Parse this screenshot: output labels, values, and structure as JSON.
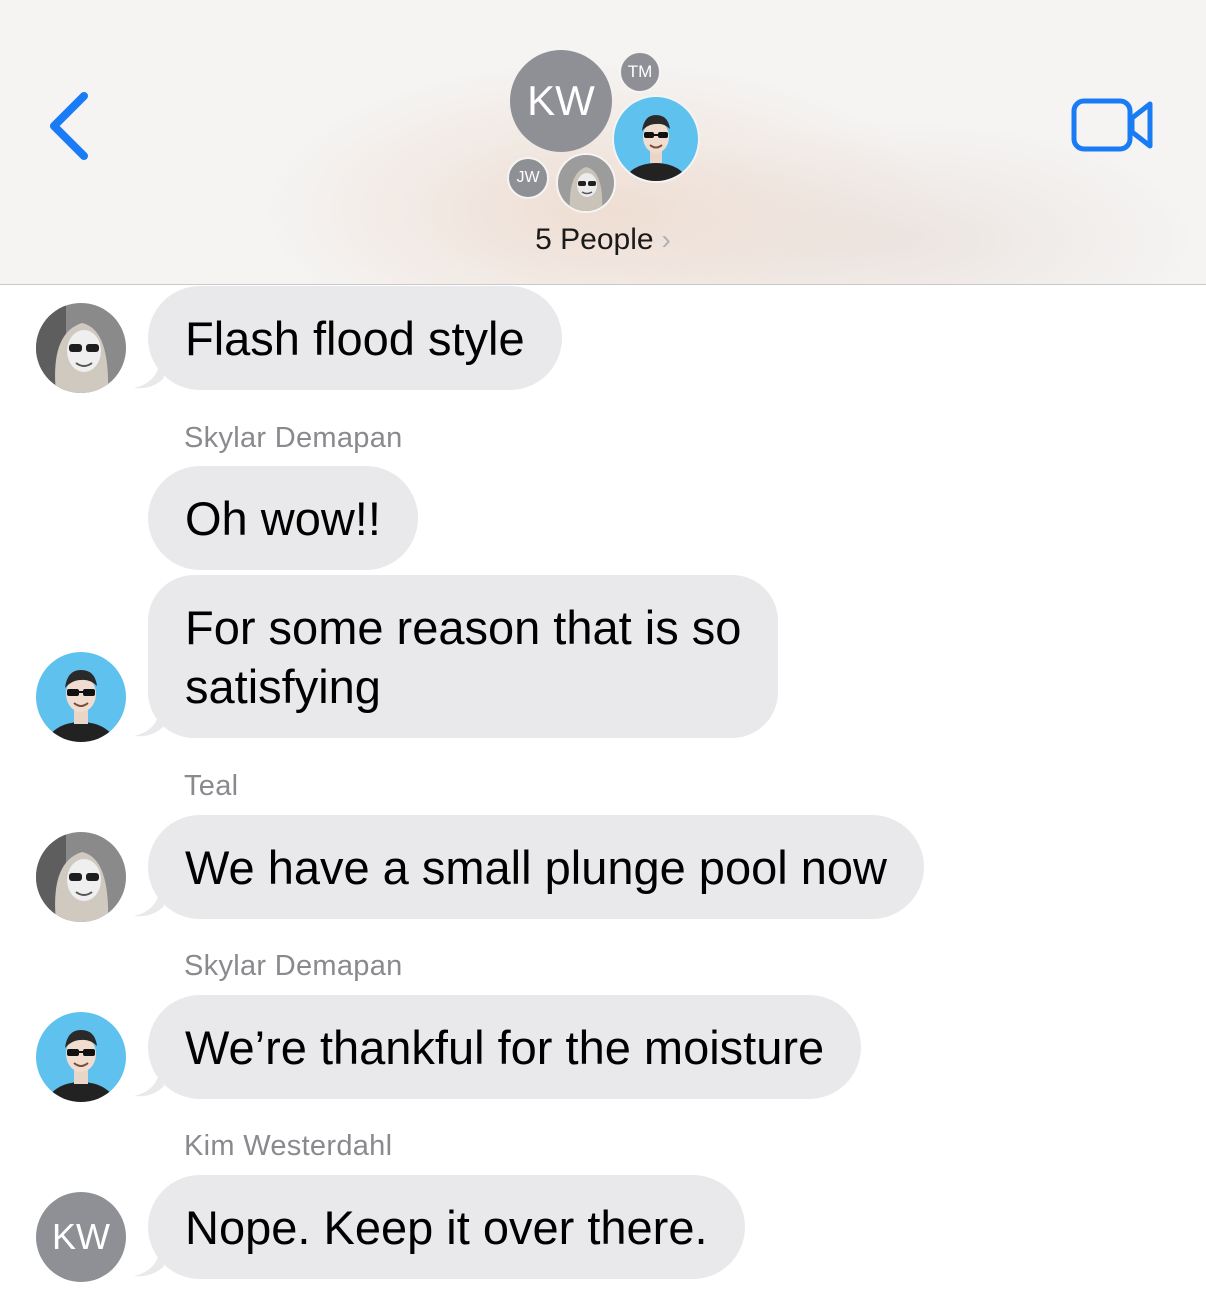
{
  "header": {
    "back_icon": "chevron-left-icon",
    "video_icon": "video-camera-icon",
    "accent_color": "#1a7cf5",
    "group_avatars": {
      "kw": "KW",
      "tm": "TM",
      "jw": "JW"
    },
    "people_label": "5 People",
    "people_chevron": "›"
  },
  "messages": [
    {
      "sender": "",
      "text": "Flash flood style",
      "avatar": "skylar-photo"
    },
    {
      "sender": "Skylar Demapan",
      "text": "Oh wow!!",
      "avatar": ""
    },
    {
      "sender": "",
      "text_line1": "For some reason that is so",
      "text_line2": "satisfying",
      "avatar": "teal-photo"
    },
    {
      "sender": "Teal",
      "text": "We have a small plunge pool now",
      "avatar": "skylar-photo"
    },
    {
      "sender": "Skylar Demapan",
      "text": "We’re thankful for the moisture",
      "avatar": "teal-photo"
    },
    {
      "sender": "Kim Westerdahl",
      "text": "Nope. Keep it over there.",
      "avatar_initials": "KW"
    }
  ],
  "colors": {
    "bubble": "#e9e9eb",
    "sender_label": "#8a8a8e",
    "teal_avatar_bg": "#5fc1ee",
    "initials_avatar_bg": "#8f9096"
  }
}
